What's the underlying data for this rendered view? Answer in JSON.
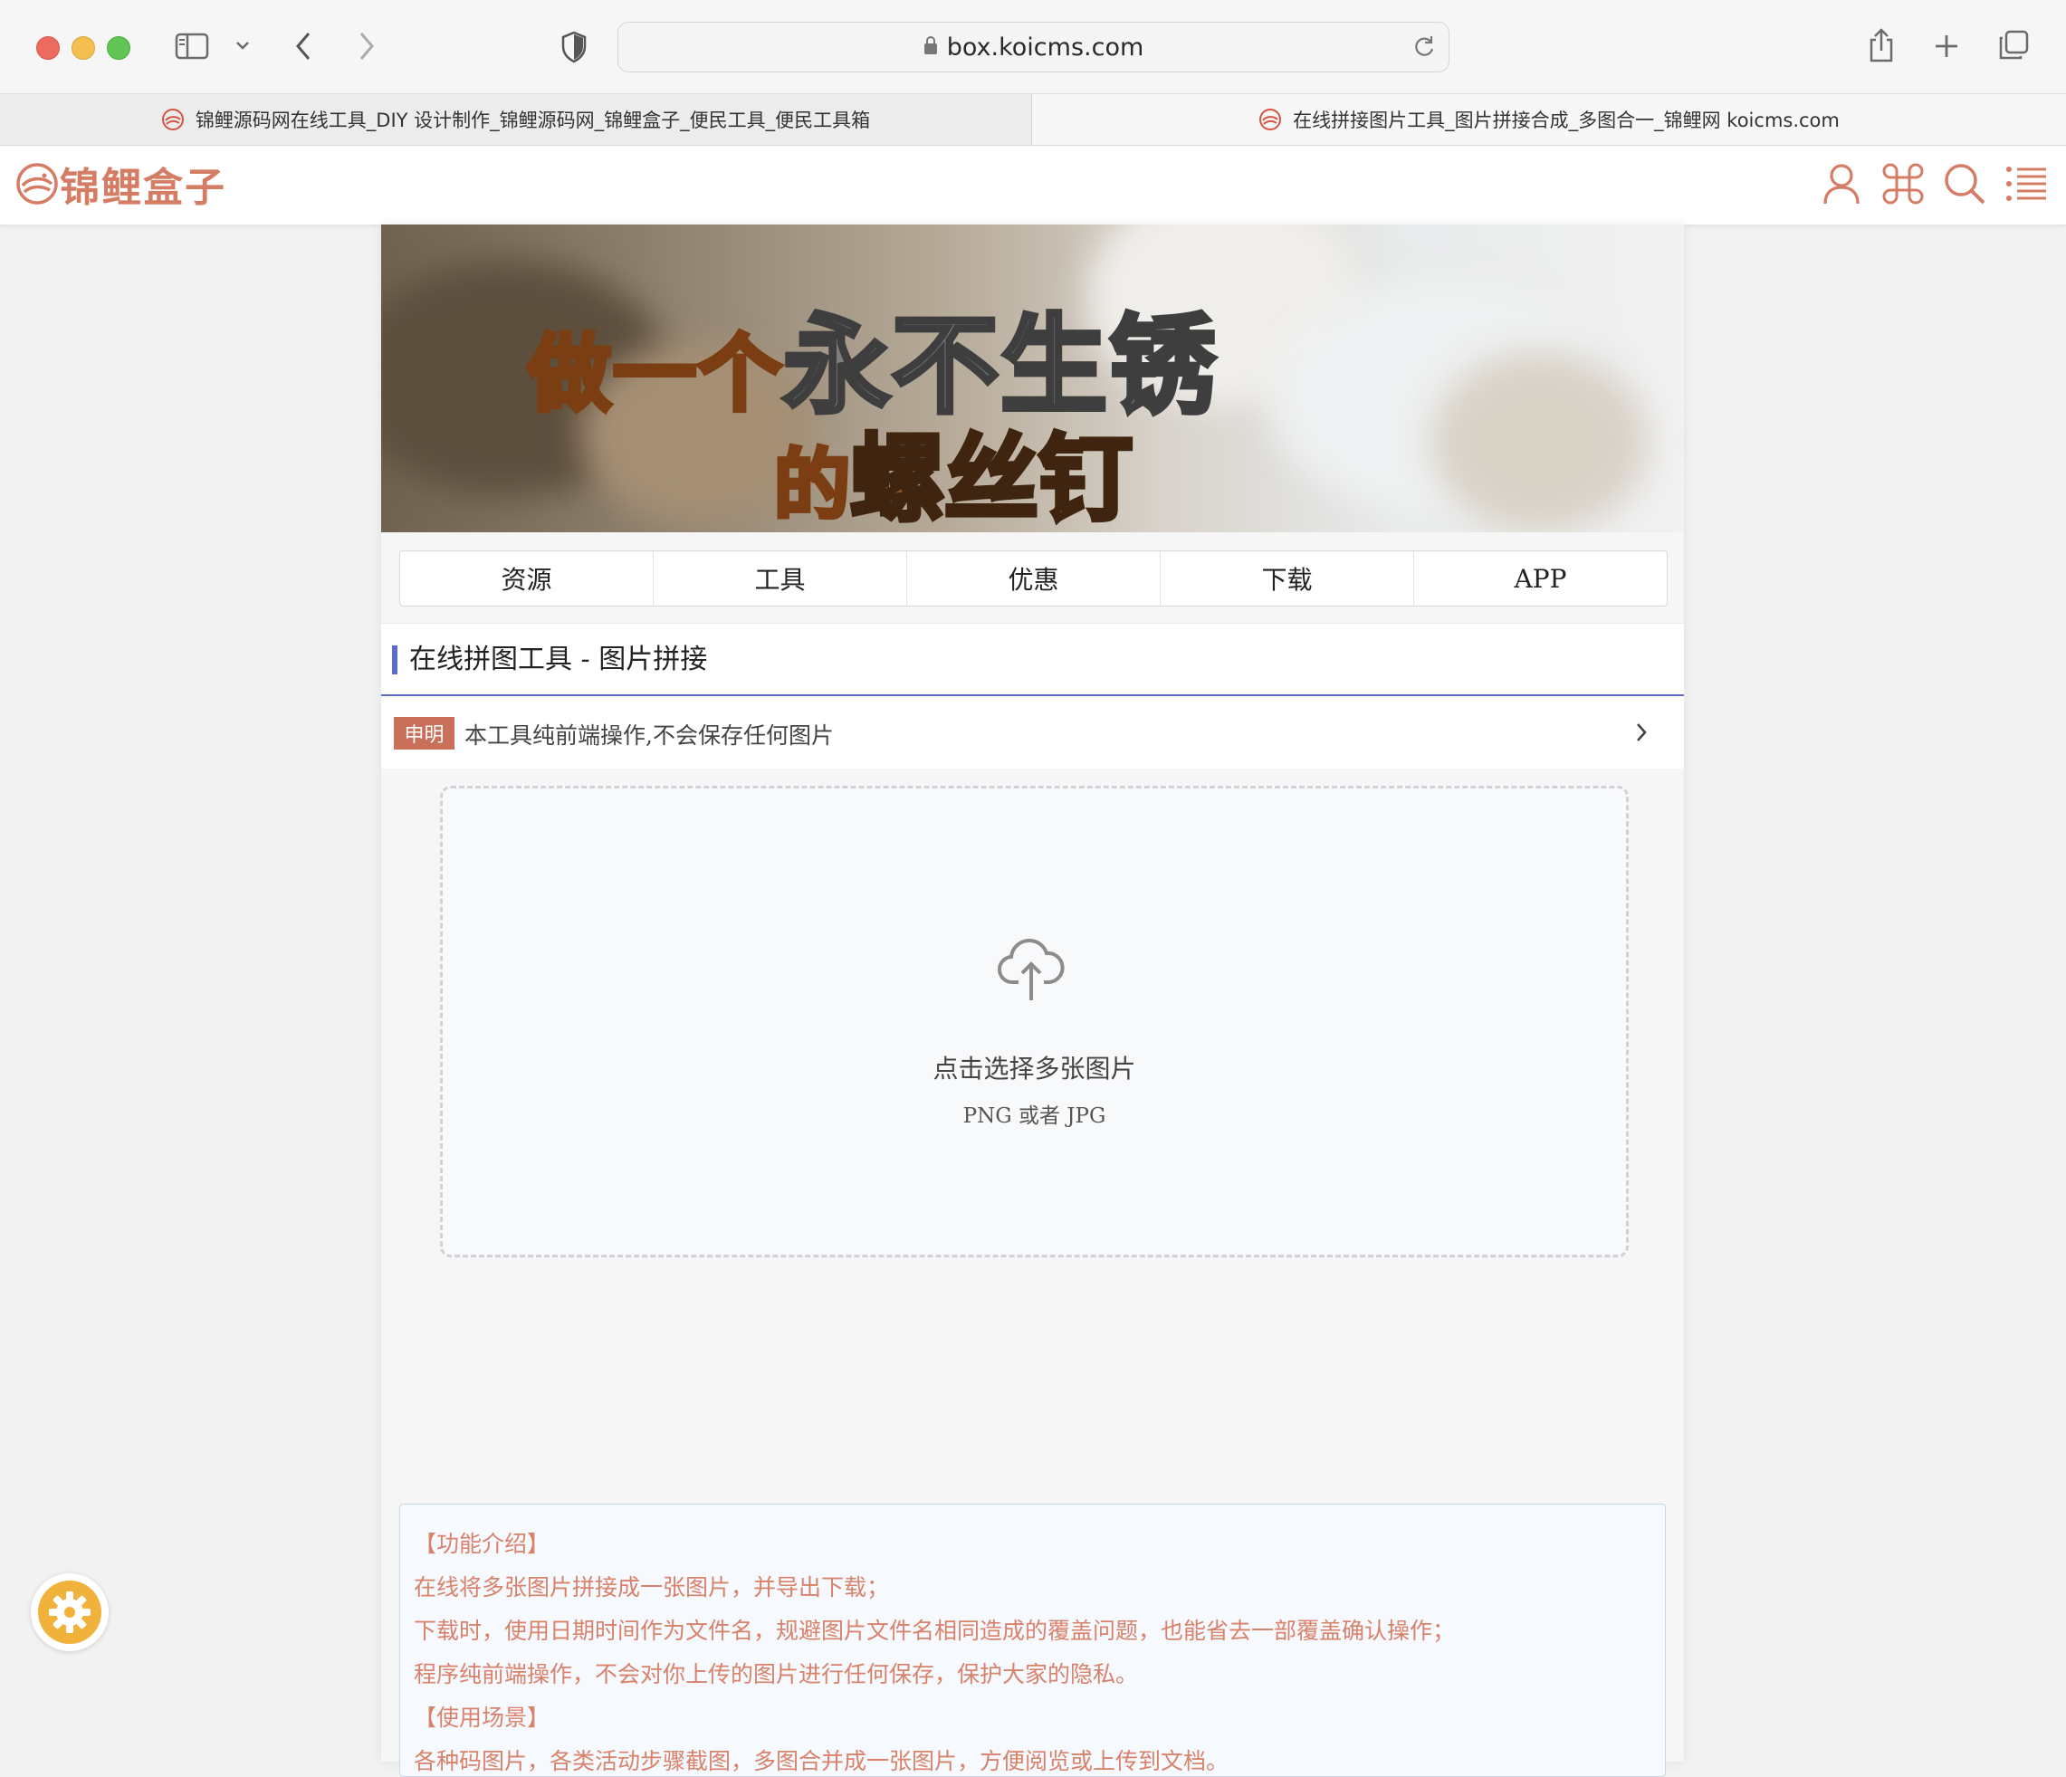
{
  "browser": {
    "url": "box.koicms.com",
    "tabs": [
      {
        "title": "锦鲤源码网在线工具_DIY 设计制作_锦鲤源码网_锦鲤盒子_便民工具_便民工具箱",
        "active": true
      },
      {
        "title": "在线拼接图片工具_图片拼接合成_多图合一_锦鲤网 koicms.com",
        "active": false
      }
    ]
  },
  "site": {
    "logo_text": "锦鲤盒子",
    "header_icons": [
      "user-icon",
      "apps-icon",
      "search-icon",
      "menu-list-icon"
    ]
  },
  "banner": {
    "line1_prefix": "做一个",
    "line1_main": "永不生锈",
    "line2_prefix": "的",
    "line2_main": "螺丝钉"
  },
  "nav": {
    "items": [
      {
        "label": "资源"
      },
      {
        "label": "工具"
      },
      {
        "label": "优惠"
      },
      {
        "label": "下载"
      },
      {
        "label": "APP"
      }
    ]
  },
  "tool": {
    "title": "在线拼图工具 - 图片拼接",
    "notice_badge": "申明",
    "notice_text": "本工具纯前端操作,不会保存任何图片"
  },
  "upload": {
    "title": "点击选择多张图片",
    "subtitle": "PNG 或者 JPG"
  },
  "info": {
    "section1_title": "【功能介绍】",
    "lines": [
      "在线将多张图片拼接成一张图片，并导出下载；",
      "下载时，使用日期时间作为文件名，规避图片文件名相同造成的覆盖问题，也能省去一部覆盖确认操作；",
      "程序纯前端操作，不会对你上传的图片进行任何保存，保护大家的隐私。"
    ],
    "section2_title": "【使用场景】",
    "scenario": "各种码图片，各类活动步骤截图，多图合并成一张图片，方便阅览或上传到文档。"
  },
  "colors": {
    "accent": "#5c6bd4",
    "brand": "#d57c64",
    "badge": "#c96f5a",
    "info_text": "#d9826b",
    "gear": "#f0b23a"
  }
}
